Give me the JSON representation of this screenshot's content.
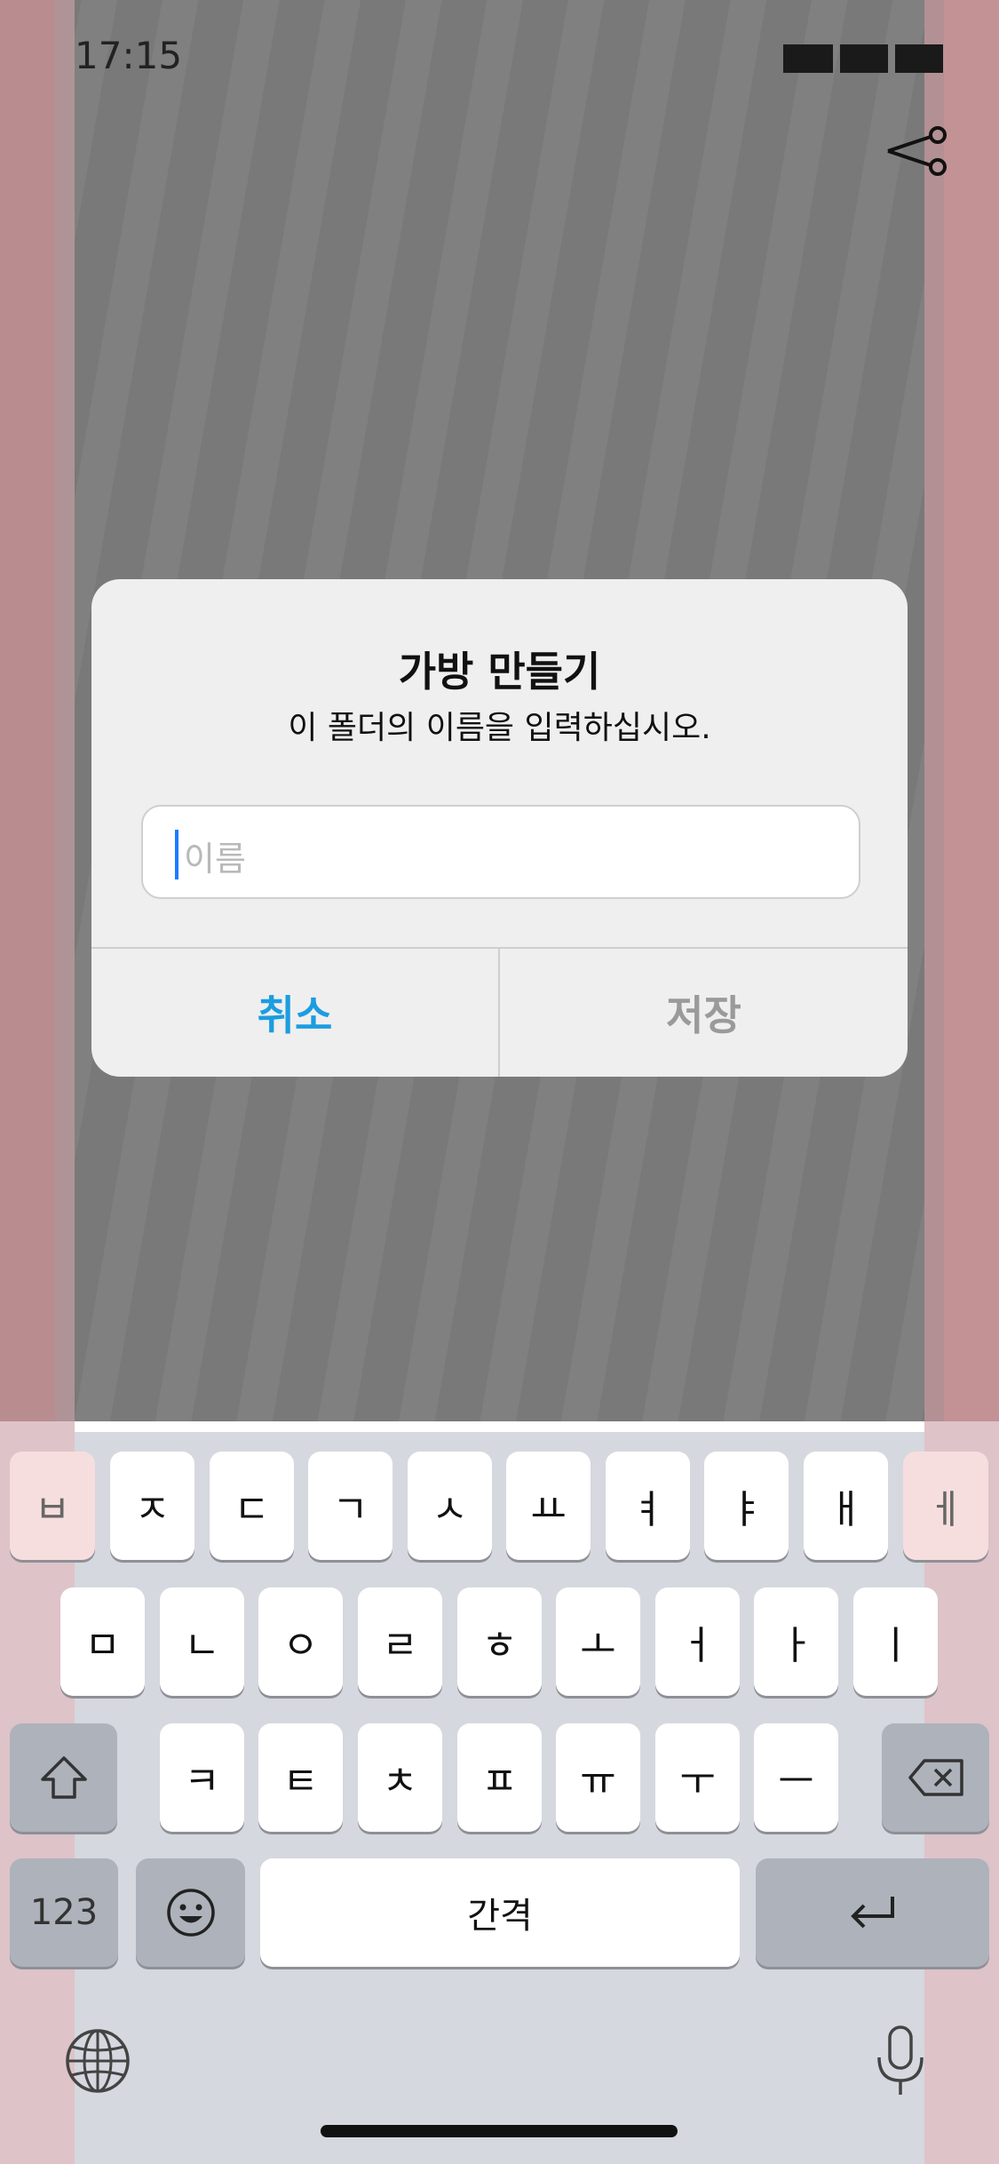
{
  "status_bar": {
    "time": "17:15"
  },
  "top_right": {
    "icon": "scissors-icon"
  },
  "dialog": {
    "title": "가방 만들기",
    "message": "이 폴더의 이름을 입력하십시오.",
    "input_placeholder": "이름",
    "input_value": "",
    "cancel_label": "취소",
    "save_label": "저장"
  },
  "keyboard": {
    "row1": [
      "ㅂ",
      "ㅈ",
      "ㄷ",
      "ㄱ",
      "ㅅ",
      "ㅛ",
      "ㅕ",
      "ㅑ",
      "ㅐ",
      "ㅔ"
    ],
    "row2": [
      "ㅁ",
      "ㄴ",
      "ㅇ",
      "ㄹ",
      "ㅎ",
      "ㅗ",
      "ㅓ",
      "ㅏ",
      "ㅣ"
    ],
    "row3": [
      "ㅋ",
      "ㅌ",
      "ㅊ",
      "ㅍ",
      "ㅠ",
      "ㅜ",
      "ㅡ"
    ],
    "numbers_label": "123",
    "space_label": "간격",
    "accent_color": "#1b9de0"
  }
}
